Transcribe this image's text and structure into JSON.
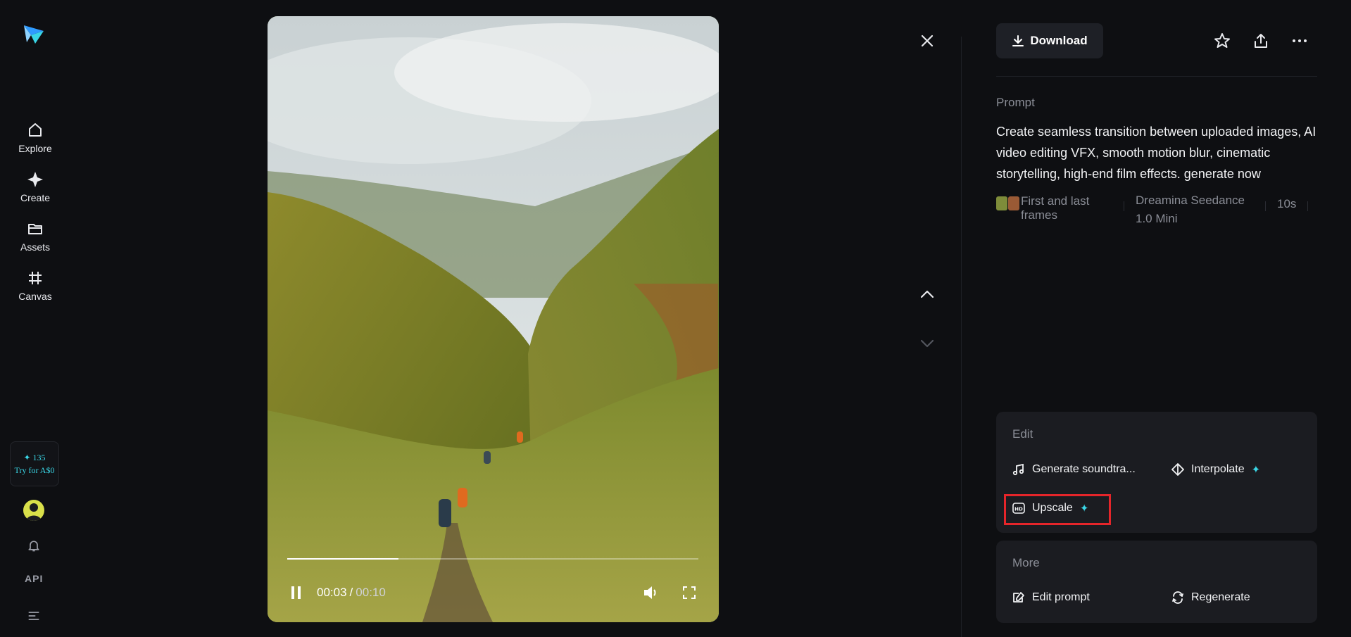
{
  "sidebar": {
    "items": [
      {
        "label": "Explore",
        "icon": "home-icon"
      },
      {
        "label": "Create",
        "icon": "sparkle-icon"
      },
      {
        "label": "Assets",
        "icon": "folder-icon"
      },
      {
        "label": "Canvas",
        "icon": "canvas-icon"
      }
    ],
    "credits": {
      "count": "135",
      "offer": "Try for A$0"
    },
    "api_label": "API"
  },
  "player": {
    "current_time": "00:03",
    "separator": "/",
    "total_time": "00:10",
    "progress": 0.27
  },
  "panel": {
    "download_label": "Download",
    "prompt_label": "Prompt",
    "prompt_text": "Create seamless transition between uploaded images, AI video editing VFX, smooth motion blur, cinematic storytelling, high-end film effects. generate now",
    "meta": {
      "mode": "First and last frames",
      "model": "Dreamina Seedance 1.0 Mini",
      "duration": "10s"
    },
    "edit": {
      "title": "Edit",
      "actions": [
        {
          "label": "Generate soundtra..."
        },
        {
          "label": "Interpolate"
        },
        {
          "label": "Upscale"
        }
      ]
    },
    "more": {
      "title": "More",
      "actions": [
        {
          "label": "Edit prompt"
        },
        {
          "label": "Regenerate"
        }
      ]
    }
  },
  "colors": {
    "accent": "#3ad6e6",
    "highlight": "#e5252a"
  }
}
